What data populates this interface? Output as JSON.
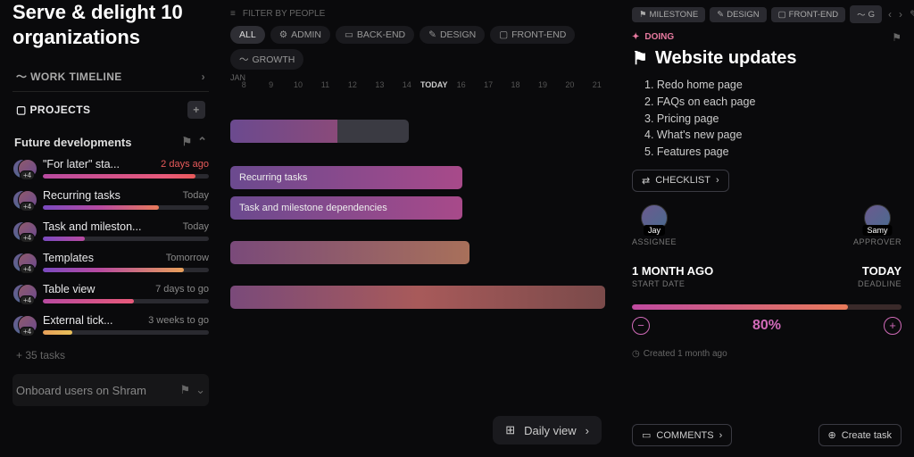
{
  "sidebar": {
    "title": "Serve & delight 10 organizations",
    "work_timeline": "WORK TIMELINE",
    "projects_label": "PROJECTS",
    "group_title": "Future developments",
    "tasks": [
      {
        "name": "\"For later\" sta...",
        "date": "2 days ago",
        "overdue": true,
        "more": "+4"
      },
      {
        "name": "Recurring tasks",
        "date": "Today",
        "overdue": false,
        "more": "+4"
      },
      {
        "name": "Task and mileston...",
        "date": "Today",
        "overdue": false,
        "more": "+4"
      },
      {
        "name": "Templates",
        "date": "Tomorrow",
        "overdue": false,
        "more": "+4"
      },
      {
        "name": "Table view",
        "date": "7 days to go",
        "overdue": false,
        "more": "+4"
      },
      {
        "name": "External tick...",
        "date": "3 weeks to go",
        "overdue": false,
        "more": "+4"
      }
    ],
    "more_tasks": "+ 35 tasks",
    "collapsed_group": "Onboard users on Shram"
  },
  "timeline": {
    "filter_label": "FILTER BY PEOPLE",
    "pills": [
      "ALL",
      "ADMIN",
      "BACK-END",
      "DESIGN",
      "FRONT-END",
      "GROWTH"
    ],
    "month": "JAN",
    "dates": [
      "8",
      "9",
      "10",
      "11",
      "12",
      "13",
      "14",
      "TODAY",
      "16",
      "17",
      "18",
      "19",
      "20",
      "21"
    ],
    "bars": [
      {
        "label": ""
      },
      {
        "label": "Recurring tasks"
      },
      {
        "label": "Task and milestone dependencies"
      },
      {
        "label": ""
      },
      {
        "label": ""
      }
    ],
    "view_toggle": "Daily view"
  },
  "detail": {
    "tags": [
      "MILESTONE",
      "DESIGN",
      "FRONT-END",
      "G"
    ],
    "status": "DOING",
    "title": "Website updates",
    "items": [
      "Redo home page",
      "FAQs on each page",
      "Pricing page",
      "What's new page",
      "Features page"
    ],
    "checklist_btn": "CHECKLIST",
    "assignee": {
      "name": "Jay",
      "role": "ASSIGNEE"
    },
    "approver": {
      "name": "Samy",
      "role": "APPROVER"
    },
    "start": {
      "val": "1 MONTH AGO",
      "lbl": "START DATE"
    },
    "deadline": {
      "val": "TODAY",
      "lbl": "DEADLINE"
    },
    "pct": "80%",
    "created": "Created 1 month ago",
    "comments_btn": "COMMENTS",
    "create_btn": "Create task"
  }
}
